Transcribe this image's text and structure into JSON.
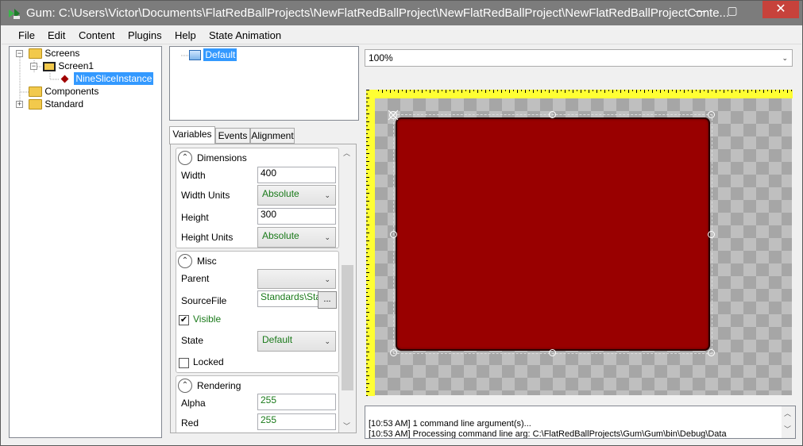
{
  "window": {
    "title": "Gum: C:\\Users\\Victor\\Documents\\FlatRedBallProjects\\NewFlatRedBallProject\\NewFlatRedBallProject\\NewFlatRedBallProjectConte...",
    "close_glyph": "✕",
    "minimize_glyph": "—",
    "maximize_glyph": "▢"
  },
  "menu": [
    "File",
    "Edit",
    "Content",
    "Plugins",
    "Help",
    "State Animation"
  ],
  "project_tree": {
    "screens": "Screens",
    "screen1": "Screen1",
    "instance": "NineSliceInstance",
    "components": "Components",
    "standard": "Standard"
  },
  "states_tree": {
    "default": "Default"
  },
  "tabs": [
    "Variables",
    "Events",
    "Alignment"
  ],
  "dimensions": {
    "title": "Dimensions",
    "width_label": "Width",
    "width_value": "400",
    "width_units_label": "Width Units",
    "width_units_value": "Absolute",
    "height_label": "Height",
    "height_value": "300",
    "height_units_label": "Height Units",
    "height_units_value": "Absolute"
  },
  "misc": {
    "title": "Misc",
    "parent_label": "Parent",
    "parent_value": "",
    "source_label": "SourceFile",
    "source_value": "Standards\\Stan",
    "browse_label": "...",
    "visible_label": "Visible",
    "visible_checked": true,
    "check_glyph": "✔",
    "state_label": "State",
    "state_value": "Default",
    "locked_label": "Locked",
    "locked_checked": false
  },
  "rendering": {
    "title": "Rendering",
    "alpha_label": "Alpha",
    "alpha_value": "255",
    "red_label": "Red",
    "red_value": "255"
  },
  "canvas": {
    "zoom": "100%",
    "fill_color": "#990000"
  },
  "output": [
    "[10:53 AM] 1 command line argument(s)...",
    "[10:53 AM] Processing command line arg: C:\\FlatRedBallProjects\\Gum\\Gum\\bin\\Debug\\Data"
  ]
}
